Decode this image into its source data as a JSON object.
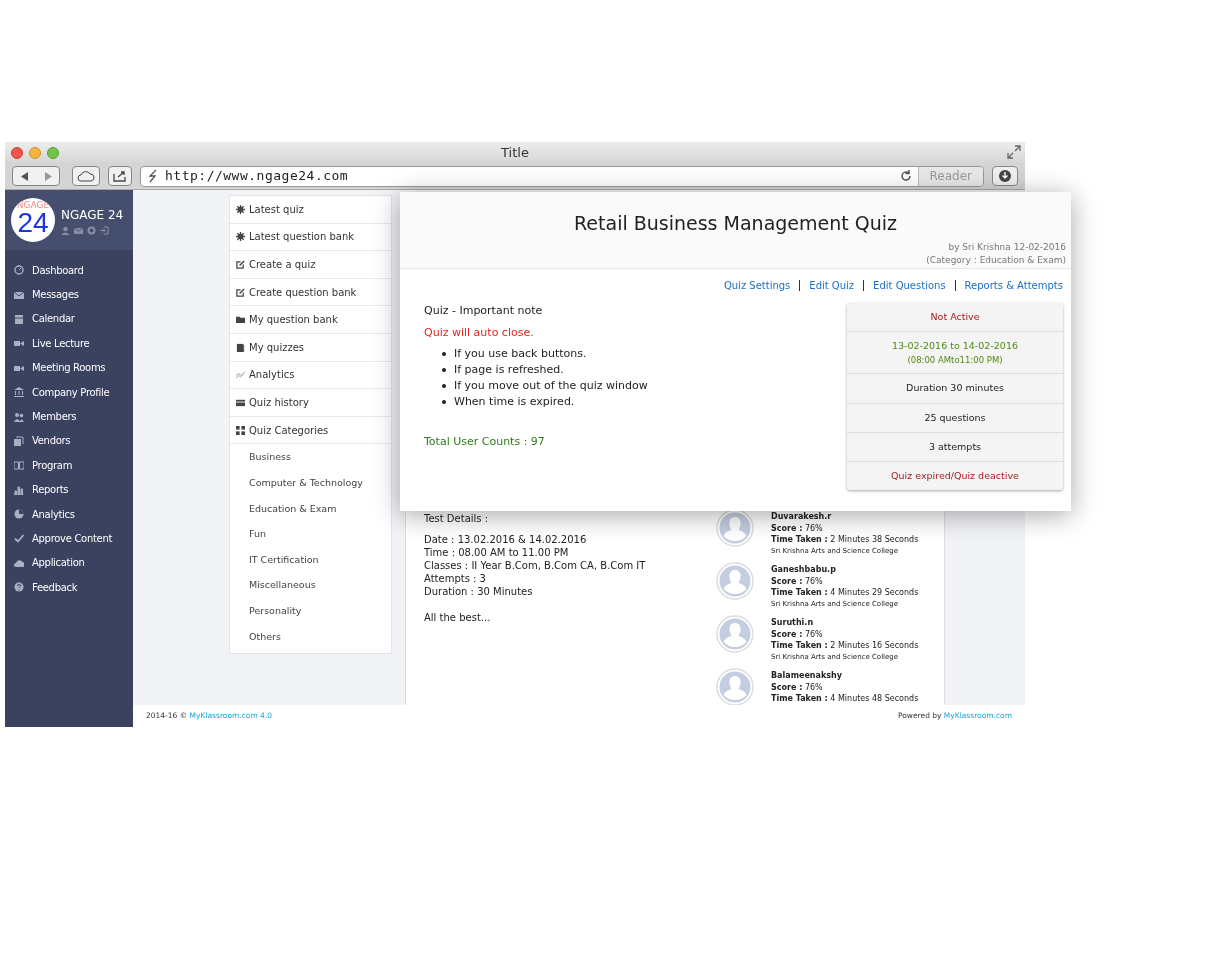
{
  "browser": {
    "title": "Title",
    "url": "http://www.ngage24.com",
    "reader_button": "Reader"
  },
  "sidebar": {
    "logo_word": "NGAGE",
    "logo_number": "24",
    "brand": "NGAGE 24",
    "items": [
      "Dashboard",
      "Messages",
      "Calendar",
      "Live Lecture",
      "Meeting Rooms",
      "Company Profile",
      "Members",
      "Vendors",
      "Program",
      "Reports",
      "Analytics",
      "Approve Content",
      "Application",
      "Feedback"
    ]
  },
  "submenu": {
    "items": [
      "Latest quiz",
      "Latest question bank",
      "Create a quiz",
      "Create question bank",
      "My question bank",
      "My quizzes",
      "Analytics",
      "Quiz history",
      "Quiz Categories"
    ],
    "categories": [
      "Business",
      "Computer & Technology",
      "Education & Exam",
      "Fun",
      "IT Certification",
      "Miscellaneous",
      "Personality",
      "Others"
    ]
  },
  "content": {
    "heading": "Test Details :",
    "details": [
      "Date : 13.02.2016 & 14.02.2016",
      "Time : 08.00 AM to 11.00 PM",
      "Classes : II Year B.Com, B.Com CA, B.Com IT",
      "Attempts : 3",
      "Duration : 30 Minutes"
    ],
    "closing": "All the best...",
    "attempts": [
      {
        "name": "Duvarakesh.r",
        "score": "**Score :** 76%",
        "time": "**Time Taken :** 2 Minutes 38 Seconds",
        "college": "Sri Krishna Arts and Science College"
      },
      {
        "name": "Ganeshbabu.p",
        "score": "**Score :** 76%",
        "time": "**Time Taken :** 4 Minutes 29 Seconds",
        "college": "Sri Krishna Arts and Science College"
      },
      {
        "name": "Suruthi.n",
        "score": "**Score :** 76%",
        "time": "**Time Taken :** 2 Minutes 16 Seconds",
        "college": "Sri Krishna Arts and Science College"
      },
      {
        "name": "Balameenakshy",
        "score": "**Score :** 76%",
        "time": "**Time Taken :** 4 Minutes 48 Seconds"
      }
    ]
  },
  "modal": {
    "title": "Retail Business Management Quiz",
    "byline": "by Sri Krishna 12-02-2016",
    "category": "(Category : Education & Exam)",
    "links": [
      "Quiz Settings",
      "Edit Quiz",
      "Edit Questions",
      "Reports & Attempts"
    ],
    "note_title": "Quiz - Important note",
    "warning": "Quiz will auto close.",
    "bullets": [
      "If you use back buttons.",
      "If page is refreshed.",
      "If you move out of the quiz window",
      "When time is expired."
    ],
    "total": "Total User Counts : 97",
    "status": [
      {
        "kind": "alert",
        "lines": [
          "Not Active"
        ]
      },
      {
        "kind": "dates",
        "lines": [
          "13-02-2016 to 14-02-2016",
          "(08:00 AMto11:00 PM)"
        ]
      },
      {
        "kind": "plain",
        "lines": [
          "Duration 30 minutes"
        ]
      },
      {
        "kind": "plain",
        "lines": [
          "25 questions"
        ]
      },
      {
        "kind": "plain",
        "lines": [
          "3 attempts"
        ]
      },
      {
        "kind": "alert",
        "lines": [
          "Quiz expired/Quiz deactive"
        ]
      }
    ]
  },
  "footer": {
    "left": "2014-16 ©",
    "left_link": "MyKlassroom.com 4.0",
    "right": "Powered by",
    "right_link": "MyKlassroom.com"
  }
}
